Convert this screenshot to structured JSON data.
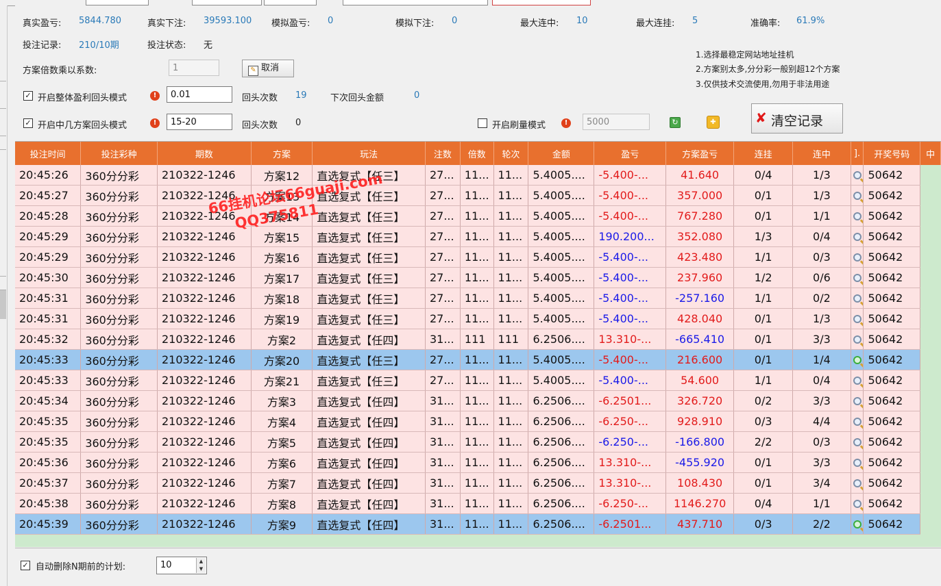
{
  "stats": {
    "real_profit_label": "真实盈亏:",
    "real_profit_value": "5844.780",
    "real_bet_label": "真实下注:",
    "real_bet_value": "39593.100",
    "sim_profit_label": "模拟盈亏:",
    "sim_profit_value": "0",
    "sim_bet_label": "模拟下注:",
    "sim_bet_value": "0",
    "max_win_streak_label": "最大连中:",
    "max_win_streak_value": "10",
    "max_lose_streak_label": "最大连挂:",
    "max_lose_streak_value": "5",
    "accuracy_label": "准确率:",
    "accuracy_value": "61.9%",
    "bet_record_label": "投注记录:",
    "bet_record_value": "210/10期",
    "bet_status_label": "投注状态:",
    "bet_status_value": "无"
  },
  "controls": {
    "multiplier_label": "方案倍数乘以系数:",
    "multiplier_value": "1",
    "cancel_label": "取消",
    "profit_return_label": "开启整体盈利回头模式",
    "profit_return_value": "0.01",
    "return_count_label": "回头次数",
    "return_count_value": "19",
    "next_return_label": "下次回头金额",
    "next_return_value": "0",
    "plan_return_label": "开启中几方案回头模式",
    "plan_return_value": "15-20",
    "return_count2_label": "回头次数",
    "return_count2_value": "0",
    "brush_label": "开启刷量模式",
    "brush_value": "5000",
    "clear_label": "清空记录"
  },
  "notes": [
    "1.选择最稳定网站地址挂机",
    "2.方案别太多,分分彩一般别超12个方案",
    "3.仅供技术交流使用,勿用于非法用途"
  ],
  "table": {
    "headers": [
      "投注时间",
      "投注彩种",
      "期数",
      "方案",
      "玩法",
      "注数",
      "倍数",
      "轮次",
      "金额",
      "盈亏",
      "方案盈亏",
      "连挂",
      "连中",
      "].",
      "开奖号码",
      "中"
    ],
    "rows": [
      [
        "20:45:26",
        "360分分彩",
        "210322-1246",
        "方案12",
        "直选复式【任三】",
        "27...",
        "11...",
        "11...",
        "5.4005....",
        "-5.400-...",
        "41.640",
        "0/4",
        "1/3",
        "",
        "50642"
      ],
      [
        "20:45:27",
        "360分分彩",
        "210322-1246",
        "方案13",
        "直选复式【任三】",
        "27...",
        "11...",
        "11...",
        "5.4005....",
        "-5.400-...",
        "357.000",
        "0/1",
        "1/3",
        "",
        "50642"
      ],
      [
        "20:45:28",
        "360分分彩",
        "210322-1246",
        "方案14",
        "直选复式【任三】",
        "27...",
        "11...",
        "11...",
        "5.4005....",
        "-5.400-...",
        "767.280",
        "0/1",
        "1/1",
        "",
        "50642"
      ],
      [
        "20:45:29",
        "360分分彩",
        "210322-1246",
        "方案15",
        "直选复式【任三】",
        "27...",
        "11...",
        "11...",
        "5.4005....",
        "190.200...",
        "352.080",
        "1/3",
        "0/4",
        "",
        "50642"
      ],
      [
        "20:45:29",
        "360分分彩",
        "210322-1246",
        "方案16",
        "直选复式【任三】",
        "27...",
        "11...",
        "11...",
        "5.4005....",
        "-5.400-...",
        "423.480",
        "1/1",
        "0/3",
        "",
        "50642"
      ],
      [
        "20:45:30",
        "360分分彩",
        "210322-1246",
        "方案17",
        "直选复式【任三】",
        "27...",
        "11...",
        "11...",
        "5.4005....",
        "-5.400-...",
        "237.960",
        "1/2",
        "0/6",
        "",
        "50642"
      ],
      [
        "20:45:31",
        "360分分彩",
        "210322-1246",
        "方案18",
        "直选复式【任三】",
        "27...",
        "11...",
        "11...",
        "5.4005....",
        "-5.400-...",
        "-257.160",
        "1/1",
        "0/2",
        "",
        "50642"
      ],
      [
        "20:45:31",
        "360分分彩",
        "210322-1246",
        "方案19",
        "直选复式【任三】",
        "27...",
        "11...",
        "11...",
        "5.4005....",
        "-5.400-...",
        "428.040",
        "0/1",
        "1/3",
        "",
        "50642"
      ],
      [
        "20:45:32",
        "360分分彩",
        "210322-1246",
        "方案2",
        "直选复式【任四】",
        "31...",
        "111",
        "111",
        "6.2506....",
        "13.310-...",
        "-665.410",
        "0/1",
        "3/3",
        "",
        "50642"
      ],
      [
        "20:45:33",
        "360分分彩",
        "210322-1246",
        "方案20",
        "直选复式【任三】",
        "27...",
        "11...",
        "11...",
        "5.4005....",
        "-5.400-...",
        "216.600",
        "0/1",
        "1/4",
        "",
        "50642"
      ],
      [
        "20:45:33",
        "360分分彩",
        "210322-1246",
        "方案21",
        "直选复式【任三】",
        "27...",
        "11...",
        "11...",
        "5.4005....",
        "-5.400-...",
        "54.600",
        "1/1",
        "0/4",
        "",
        "50642"
      ],
      [
        "20:45:34",
        "360分分彩",
        "210322-1246",
        "方案3",
        "直选复式【任四】",
        "31...",
        "11...",
        "11...",
        "6.2506....",
        "-6.2501...",
        "326.720",
        "0/2",
        "3/3",
        "",
        "50642"
      ],
      [
        "20:45:35",
        "360分分彩",
        "210322-1246",
        "方案4",
        "直选复式【任四】",
        "31...",
        "11...",
        "11...",
        "6.2506....",
        "-6.250-...",
        "928.910",
        "0/3",
        "4/4",
        "",
        "50642"
      ],
      [
        "20:45:35",
        "360分分彩",
        "210322-1246",
        "方案5",
        "直选复式【任四】",
        "31...",
        "11...",
        "11...",
        "6.2506....",
        "-6.250-...",
        "-166.800",
        "2/2",
        "0/3",
        "",
        "50642"
      ],
      [
        "20:45:36",
        "360分分彩",
        "210322-1246",
        "方案6",
        "直选复式【任四】",
        "31...",
        "11...",
        "11...",
        "6.2506....",
        "13.310-...",
        "-455.920",
        "0/1",
        "3/3",
        "",
        "50642"
      ],
      [
        "20:45:37",
        "360分分彩",
        "210322-1246",
        "方案7",
        "直选复式【任四】",
        "31...",
        "11...",
        "11...",
        "6.2506....",
        "13.310-...",
        "108.430",
        "0/1",
        "3/4",
        "",
        "50642"
      ],
      [
        "20:45:38",
        "360分分彩",
        "210322-1246",
        "方案8",
        "直选复式【任四】",
        "31...",
        "11...",
        "11...",
        "6.2506....",
        "-6.250-...",
        "1146.270",
        "0/4",
        "1/1",
        "",
        "50642"
      ],
      [
        "20:45:39",
        "360分分彩",
        "210322-1246",
        "方案9",
        "直选复式【任四】",
        "31...",
        "11...",
        "11...",
        "6.2506....",
        "-6.2501...",
        "437.710",
        "0/3",
        "2/2",
        "",
        "50642"
      ]
    ],
    "selected_rows": [
      9,
      17
    ],
    "profit_colors": {
      "col9": [
        "red",
        "red",
        "red",
        "blue",
        "blue",
        "blue",
        "blue",
        "blue",
        "red",
        "red",
        "blue",
        "red",
        "red",
        "blue",
        "red",
        "red",
        "red",
        "red"
      ],
      "col10": [
        "red",
        "red",
        "red",
        "red",
        "red",
        "red",
        "blue",
        "red",
        "blue",
        "red",
        "red",
        "red",
        "red",
        "blue",
        "blue",
        "red",
        "red",
        "red"
      ]
    }
  },
  "footer": {
    "auto_delete_label": "自动删除N期前的计划:",
    "auto_delete_value": "10"
  },
  "watermark": {
    "line1": "66挂机论坛66guaji.com",
    "line2": "QQ375811"
  },
  "colors": {
    "header_bg": "#e8702e",
    "row_bg": "#fde3e3",
    "selected_bg": "#9cc7ee",
    "positive": "#e21b1b",
    "negative": "#1a1ae8",
    "stat_value": "#2a7ab8"
  },
  "icons": {
    "warning": "warning-icon",
    "edit": "edit-icon",
    "refresh": "refresh-icon",
    "puzzle": "puzzle-icon",
    "delete": "delete-x-icon",
    "magnifier": "magnifier-icon"
  }
}
